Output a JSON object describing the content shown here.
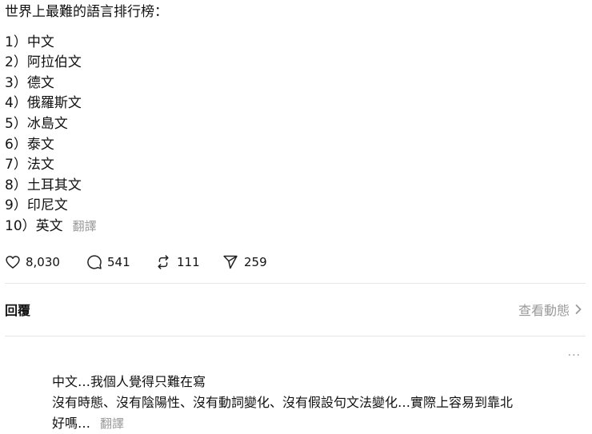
{
  "post": {
    "heading": "世界上最難的語言排行榜：",
    "lines": [
      "1）中文",
      "2）阿拉伯文",
      "3）德文",
      "4）俄羅斯文",
      "5）冰島文",
      "6）泰文",
      "7）法文",
      "8）土耳其文",
      "9）印尼文",
      "10）英文"
    ],
    "translate_label": "翻譯"
  },
  "stats": {
    "likes": "8,030",
    "replies": "541",
    "reposts": "111",
    "shares": "259"
  },
  "replies_section": {
    "title": "回覆",
    "activity_label": "查看動態",
    "more_label": "···"
  },
  "reply": {
    "lines": [
      "中文…我個人覺得只難在寫",
      "沒有時態、沒有陰陽性、沒有動詞變化、沒有假設句文法變化…實際上容易到靠北",
      "好嗎…"
    ],
    "translate_label": "翻譯"
  },
  "icons": {
    "like": "heart-icon",
    "reply": "comment-icon",
    "repost": "repost-icon",
    "share": "send-icon",
    "chevron": "chevron-right-icon",
    "more": "more-dots-icon"
  }
}
